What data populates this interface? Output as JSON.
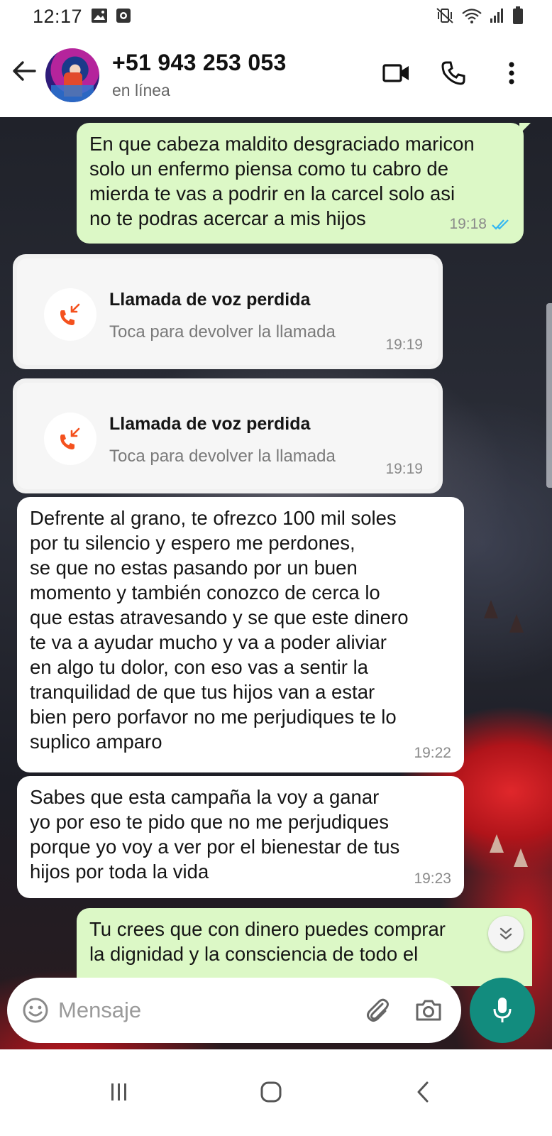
{
  "status_bar": {
    "time": "12:17",
    "icons": [
      "gallery-icon",
      "notification-icon",
      "mute-vibrate-icon",
      "wifi-icon",
      "signal-icon",
      "battery-icon"
    ]
  },
  "header": {
    "contact": "+51 943 253 053",
    "status": "en línea",
    "icons": [
      "back-arrow-icon",
      "video-call-icon",
      "voice-call-icon",
      "more-options-icon"
    ]
  },
  "messages": [
    {
      "direction": "out",
      "text": "En que cabeza maldito desgraciado maricon\nsolo un enfermo piensa como tu cabro de\nmierda te vas a podrir en la carcel solo asi\nno te podras acercar a mis hijos",
      "time": "19:18",
      "read": true
    },
    {
      "type": "missed_call",
      "title": "Llamada de voz perdida",
      "subtitle": "Toca para devolver la llamada",
      "time": "19:19"
    },
    {
      "type": "missed_call",
      "title": "Llamada de voz perdida",
      "subtitle": "Toca para devolver la llamada",
      "time": "19:19"
    },
    {
      "direction": "in",
      "text": "Defrente al grano, te ofrezco 100 mil soles\npor tu silencio y espero me perdones,\nse que no estas pasando por un buen\nmomento y también conozco de cerca lo\nque estas atravesando y se que este dinero\nte va a ayudar mucho y va a poder aliviar\nen algo tu dolor, con eso vas a sentir la\ntranquilidad de que tus hijos van a estar\nbien pero porfavor no me perjudiques te lo\nsuplico amparo",
      "time": "19:22"
    },
    {
      "direction": "in",
      "text": "Sabes que esta campaña la voy a ganar\nyo por eso te pido que no me perjudiques\nporque yo voy a ver por el bienestar de tus\nhijos por toda la vida",
      "time": "19:23"
    },
    {
      "direction": "out",
      "text": "Tu crees que con dinero puedes comprar\nla dignidad y la consciencia de todo el"
    }
  ],
  "composer": {
    "placeholder": "Mensaje",
    "icons": [
      "emoji-icon",
      "attach-icon",
      "camera-icon",
      "mic-icon"
    ]
  },
  "nav": {
    "icons": [
      "recents-icon",
      "home-icon",
      "back-icon"
    ]
  },
  "colors": {
    "outgoing": "#dcf8c6",
    "incoming": "#ffffff",
    "accent": "#128c7e",
    "missed_call": "#f4511e",
    "read_ticks": "#34b7f1"
  }
}
